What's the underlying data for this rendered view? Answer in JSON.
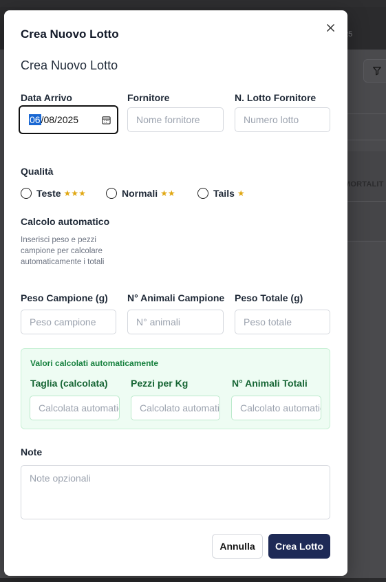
{
  "background": {
    "date_fragment": "25",
    "column_header": "MORTALIT"
  },
  "dialog": {
    "title": "Crea Nuovo Lotto",
    "close_label": "×",
    "form_title": "Crea Nuovo Lotto"
  },
  "fields": {
    "data_arrivo": {
      "label": "Data Arrivo",
      "day": "06",
      "rest": "/08/2025"
    },
    "fornitore": {
      "label": "Fornitore",
      "placeholder": "Nome fornitore"
    },
    "lotto_fornitore": {
      "label": "N. Lotto Fornitore",
      "placeholder": "Numero lotto"
    }
  },
  "quality": {
    "label": "Qualità",
    "options": [
      {
        "label": "Teste",
        "stars": "★★★"
      },
      {
        "label": "Normali",
        "stars": "★★"
      },
      {
        "label": "Tails",
        "stars": "★"
      }
    ],
    "star_color": "#e0a712"
  },
  "auto_calc": {
    "title": "Calcolo automatico",
    "description": "Inserisci peso e pezzi campione per calcolare automaticamente i totali"
  },
  "sample": {
    "peso_campione": {
      "label": "Peso Campione (g)",
      "placeholder": "Peso campione"
    },
    "animali_campione": {
      "label": "N° Animali Campione",
      "placeholder": "N° animali"
    },
    "peso_totale": {
      "label": "Peso Totale (g)",
      "placeholder": "Peso totale"
    }
  },
  "calculated": {
    "heading": "Valori calcolati automaticamente",
    "taglia": {
      "label": "Taglia (calcolata)",
      "placeholder": "Calcolata automaticamente"
    },
    "pezzi_kg": {
      "label": "Pezzi per Kg",
      "placeholder": "Calcolato automaticamente"
    },
    "animali_totali": {
      "label": "N° Animali Totali",
      "placeholder": "Calcolato automaticamente"
    },
    "accent_color": "#15803d"
  },
  "notes": {
    "label": "Note",
    "placeholder": "Note opzionali"
  },
  "actions": {
    "cancel": "Annulla",
    "submit": "Crea Lotto",
    "primary_color": "#1e2a56"
  }
}
